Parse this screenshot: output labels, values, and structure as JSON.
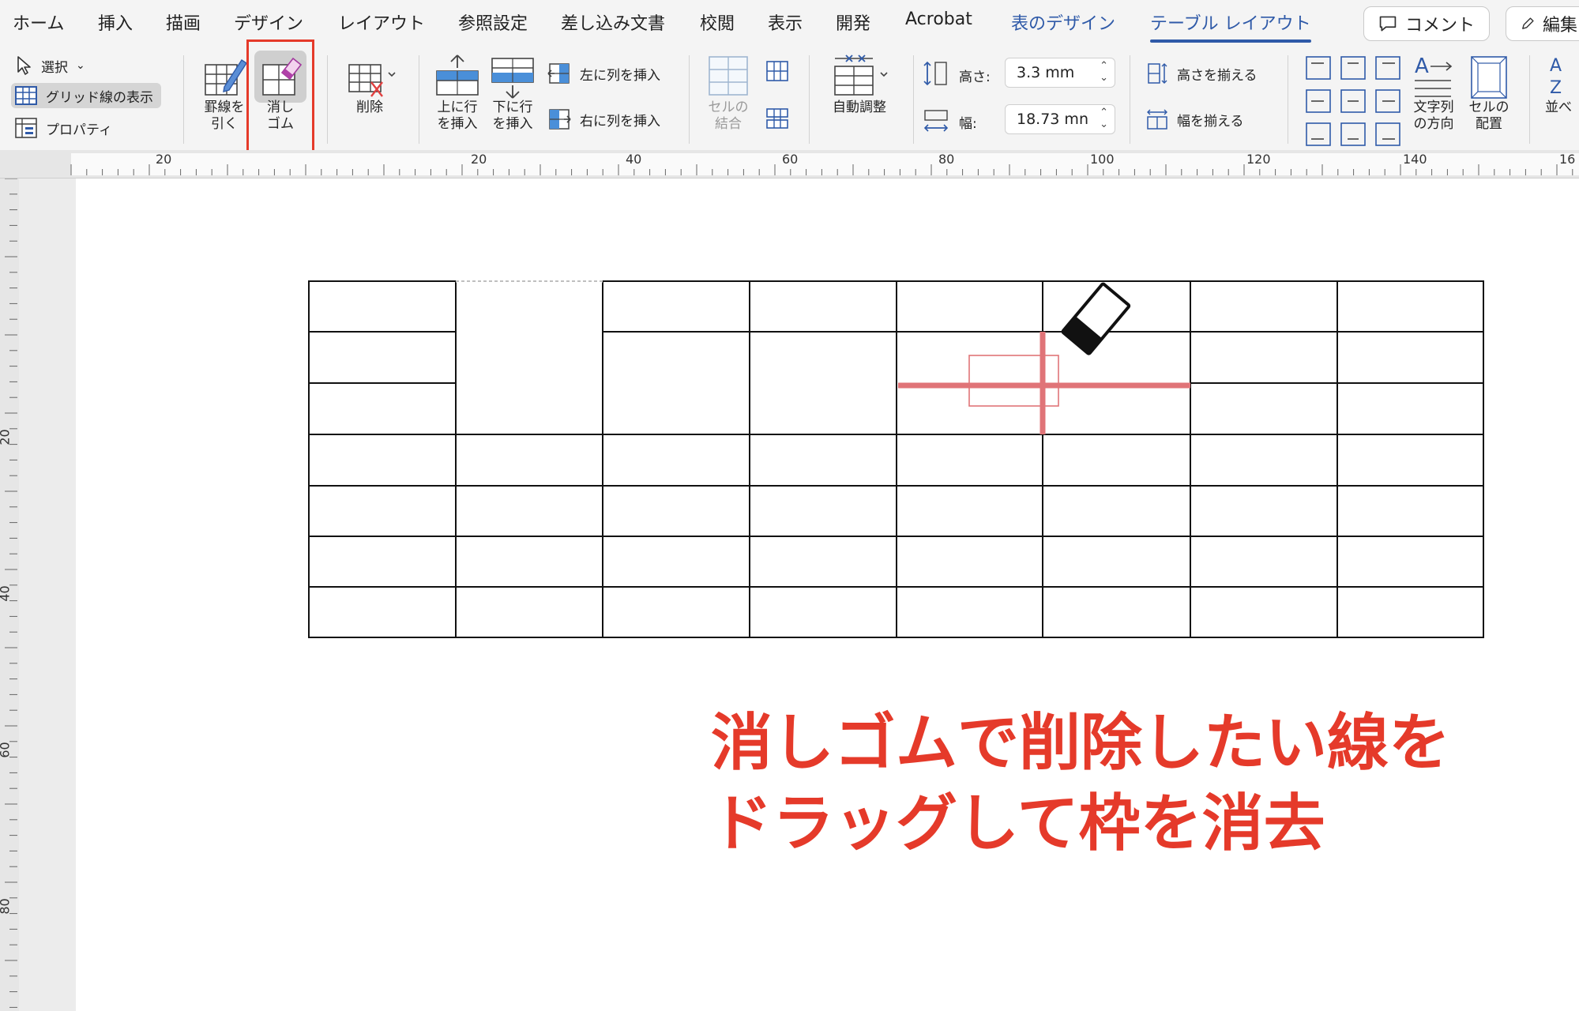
{
  "menu": {
    "tabs": [
      {
        "label": "ホーム",
        "kind": "normal"
      },
      {
        "label": "挿入",
        "kind": "normal"
      },
      {
        "label": "描画",
        "kind": "normal"
      },
      {
        "label": "デザイン",
        "kind": "normal"
      },
      {
        "label": "レイアウト",
        "kind": "normal"
      },
      {
        "label": "参照設定",
        "kind": "normal"
      },
      {
        "label": "差し込み文書",
        "kind": "normal"
      },
      {
        "label": "校閲",
        "kind": "normal"
      },
      {
        "label": "表示",
        "kind": "normal"
      },
      {
        "label": "開発",
        "kind": "normal"
      },
      {
        "label": "Acrobat",
        "kind": "normal"
      },
      {
        "label": "表のデザイン",
        "kind": "contextual"
      },
      {
        "label": "テーブル レイアウト",
        "kind": "active"
      }
    ],
    "comment_label": "コメント",
    "edit_label": "編集"
  },
  "ribbon": {
    "select_label": "選択",
    "grid_label": "グリッド線の表示",
    "properties_label": "プロパティ",
    "draw_border_label": "罫線を\n引く",
    "eraser_label": "消し\nゴム",
    "delete_label": "削除",
    "insert_above_label": "上に行\nを挿入",
    "insert_below_label": "下に行\nを挿入",
    "insert_left_label": "左に列を挿入",
    "insert_right_label": "右に列を挿入",
    "merge_label": "セルの\n結合",
    "autofit_label": "自動調整",
    "height_label": "高さ:",
    "height_value": "3.3 mm",
    "width_label": "幅:",
    "width_value": "18.73 mn",
    "distribute_rows_label": "高さを揃える",
    "distribute_cols_label": "幅を揃える",
    "text_direction_label": "文字列\nの方向",
    "cell_margins_label": "セルの\n配置",
    "sort_label": "並べ"
  },
  "ruler": {
    "h_numbers": [
      "20",
      "20",
      "40",
      "60",
      "80",
      "100",
      "120",
      "140",
      "16"
    ],
    "v_numbers": [
      "20",
      "40",
      "60",
      "80"
    ]
  },
  "instruction": "消しゴムで削除したい線を\nドラッグして枠を消去",
  "colors": {
    "accent": "#2f5aa8",
    "highlight_red": "#e53a2a",
    "erase_line": "#e07478"
  }
}
